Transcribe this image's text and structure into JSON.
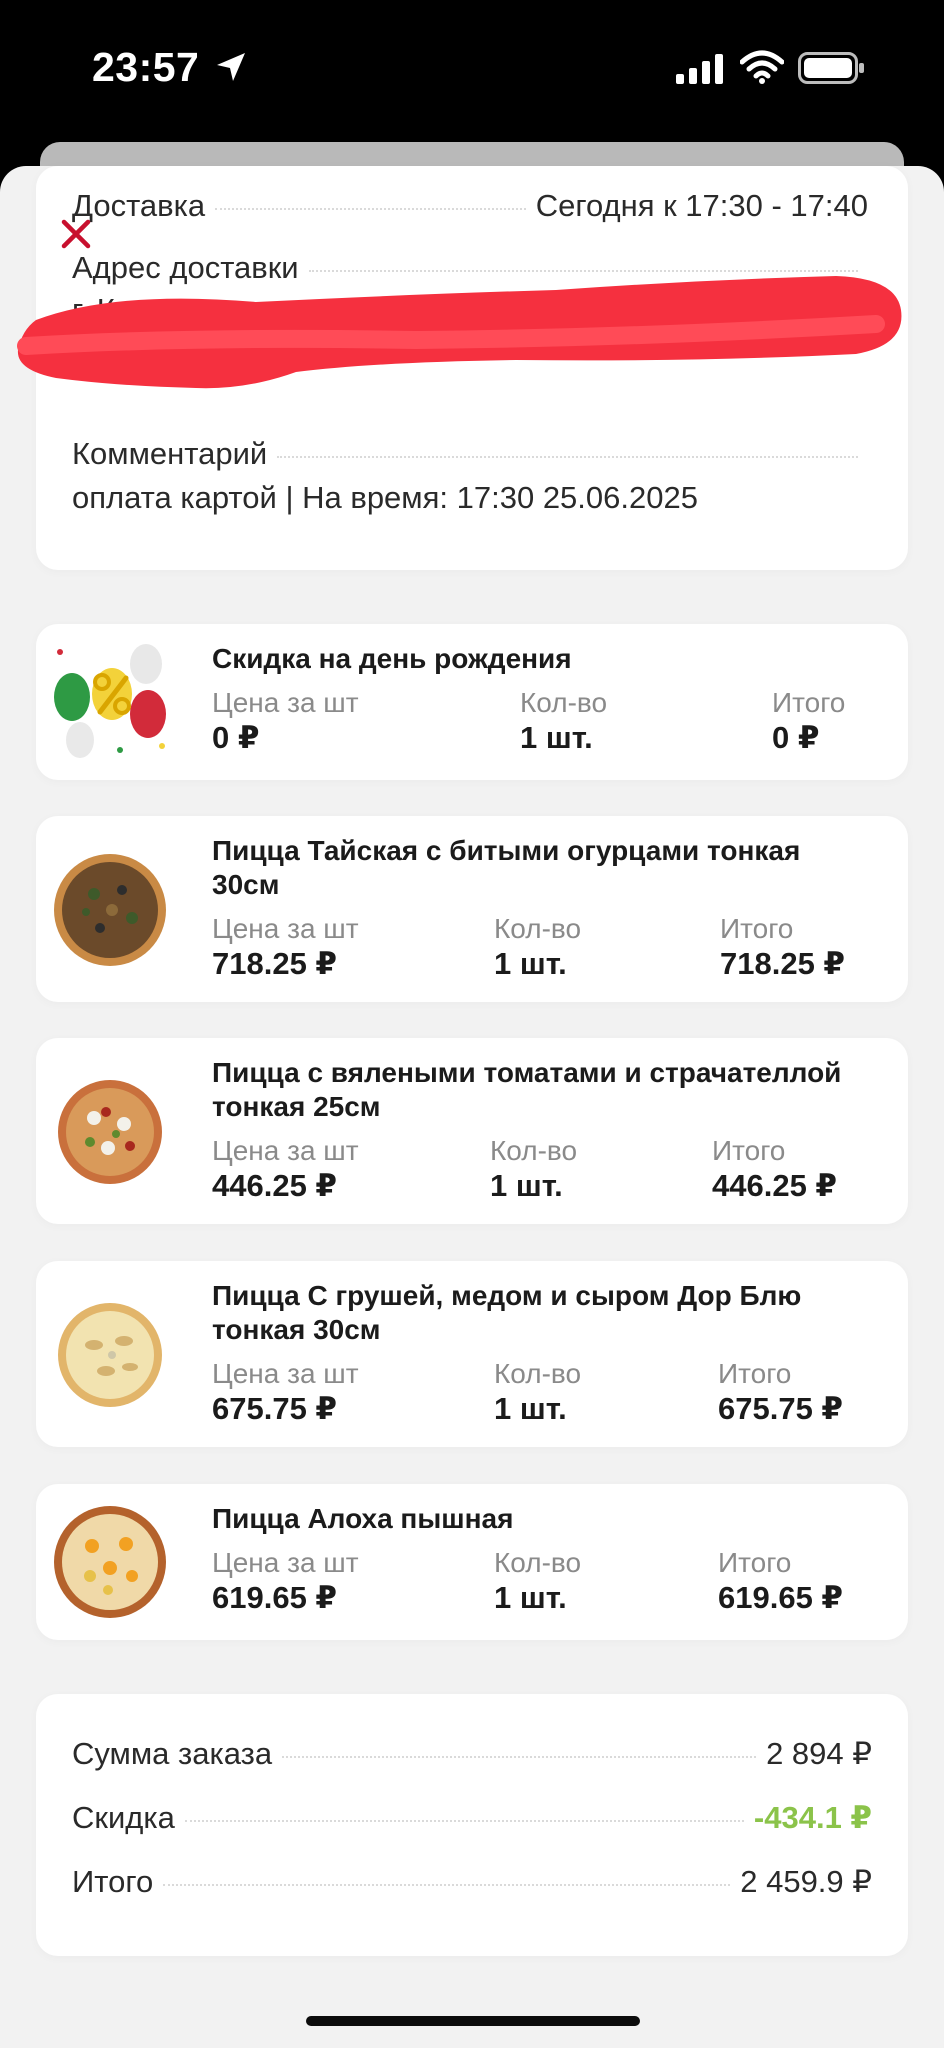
{
  "status_bar": {
    "time": "23:57"
  },
  "header": {
    "delivery_label": "Доставка",
    "delivery_time": "Сегодня к 17:30 - 17:40",
    "address_label": "Адрес доставки",
    "address_value": "г. К",
    "comment_label": "Комментарий",
    "comment_value": "оплата картой | На время: 17:30 25.06.2025"
  },
  "column_labels": {
    "price": "Цена за шт",
    "qty": "Кол-во",
    "total": "Итого"
  },
  "items": [
    {
      "title": "Скидка на день рождения",
      "price": "0 ₽",
      "qty": "1 шт.",
      "total": "0 ₽",
      "image": "birthday-balloons"
    },
    {
      "title": "Пицца Тайская с битыми огурцами тонкая 30см",
      "price": "718.25 ₽",
      "qty": "1 шт.",
      "total": "718.25 ₽",
      "image": "pizza"
    },
    {
      "title": "Пицца с вялеными томатами и страчателлой тонкая 25см",
      "price": "446.25 ₽",
      "qty": "1 шт.",
      "total": "446.25 ₽",
      "image": "pizza"
    },
    {
      "title": "Пицца С грушей, медом и сыром Дор Блю тонкая 30см",
      "price": "675.75 ₽",
      "qty": "1 шт.",
      "total": "675.75 ₽",
      "image": "pizza"
    },
    {
      "title": "Пицца Алоха пышная",
      "price": "619.65 ₽",
      "qty": "1 шт.",
      "total": "619.65 ₽",
      "image": "pizza"
    }
  ],
  "summary": {
    "subtotal_label": "Сумма заказа",
    "subtotal_value": "2 894 ₽",
    "discount_label": "Скидка",
    "discount_value": "-434.1 ₽",
    "total_label": "Итого",
    "total_value": "2 459.9 ₽"
  },
  "colors": {
    "accent_red": "#c8102e",
    "discount_green": "#8bc34a",
    "redaction": "#f5303f"
  }
}
